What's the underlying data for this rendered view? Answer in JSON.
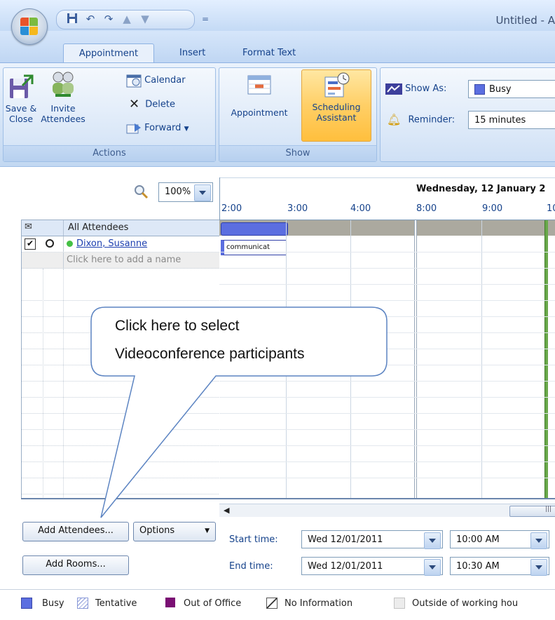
{
  "window": {
    "title": "Untitled - A"
  },
  "tabs": [
    {
      "label": "Appointment"
    },
    {
      "label": "Insert"
    },
    {
      "label": "Format Text"
    }
  ],
  "ribbon": {
    "actions": {
      "label": "Actions",
      "save_close": "Save &\nClose",
      "save_line1": "Save &",
      "save_line2": "Close",
      "invite_line1": "Invite",
      "invite_line2": "Attendees",
      "calendar": "Calendar",
      "delete": "Delete",
      "forward": "Forward"
    },
    "show": {
      "label": "Show",
      "appointment": "Appointment",
      "sched_line1": "Scheduling",
      "sched_line2": "Assistant"
    },
    "options": {
      "show_as_label": "Show As:",
      "show_as_value": "Busy",
      "reminder_label": "Reminder:",
      "reminder_value": "15 minutes"
    }
  },
  "scheduling": {
    "zoom": "100%",
    "date_header": "Wednesday, 12 January 2",
    "times": [
      "2:00",
      "3:00",
      "4:00",
      "8:00",
      "9:00",
      "10"
    ],
    "all_attendees": "All Attendees",
    "attendee": "Dixon, Susanne",
    "add_name_placeholder": "Click here to add a name",
    "busy_block_label": "communicat"
  },
  "callout": {
    "line1": "Click here to select",
    "line2": "Videoconference participants"
  },
  "controls": {
    "add_attendees": "Add Attendees...",
    "options": "Options",
    "add_rooms": "Add Rooms...",
    "start_label": "Start time:",
    "start_date": "Wed 12/01/2011",
    "start_time": "10:00 AM",
    "end_label": "End time:",
    "end_date": "Wed 12/01/2011",
    "end_time": "10:30 AM"
  },
  "legend": {
    "busy": "Busy",
    "tentative": "Tentative",
    "out_of_office": "Out of Office",
    "no_information": "No Information",
    "outside_hours": "Outside of working hou",
    "colors": {
      "busy": "#5b6ee0",
      "out_of_office": "#7a0f73",
      "tentative": "#8a9ad8"
    }
  }
}
